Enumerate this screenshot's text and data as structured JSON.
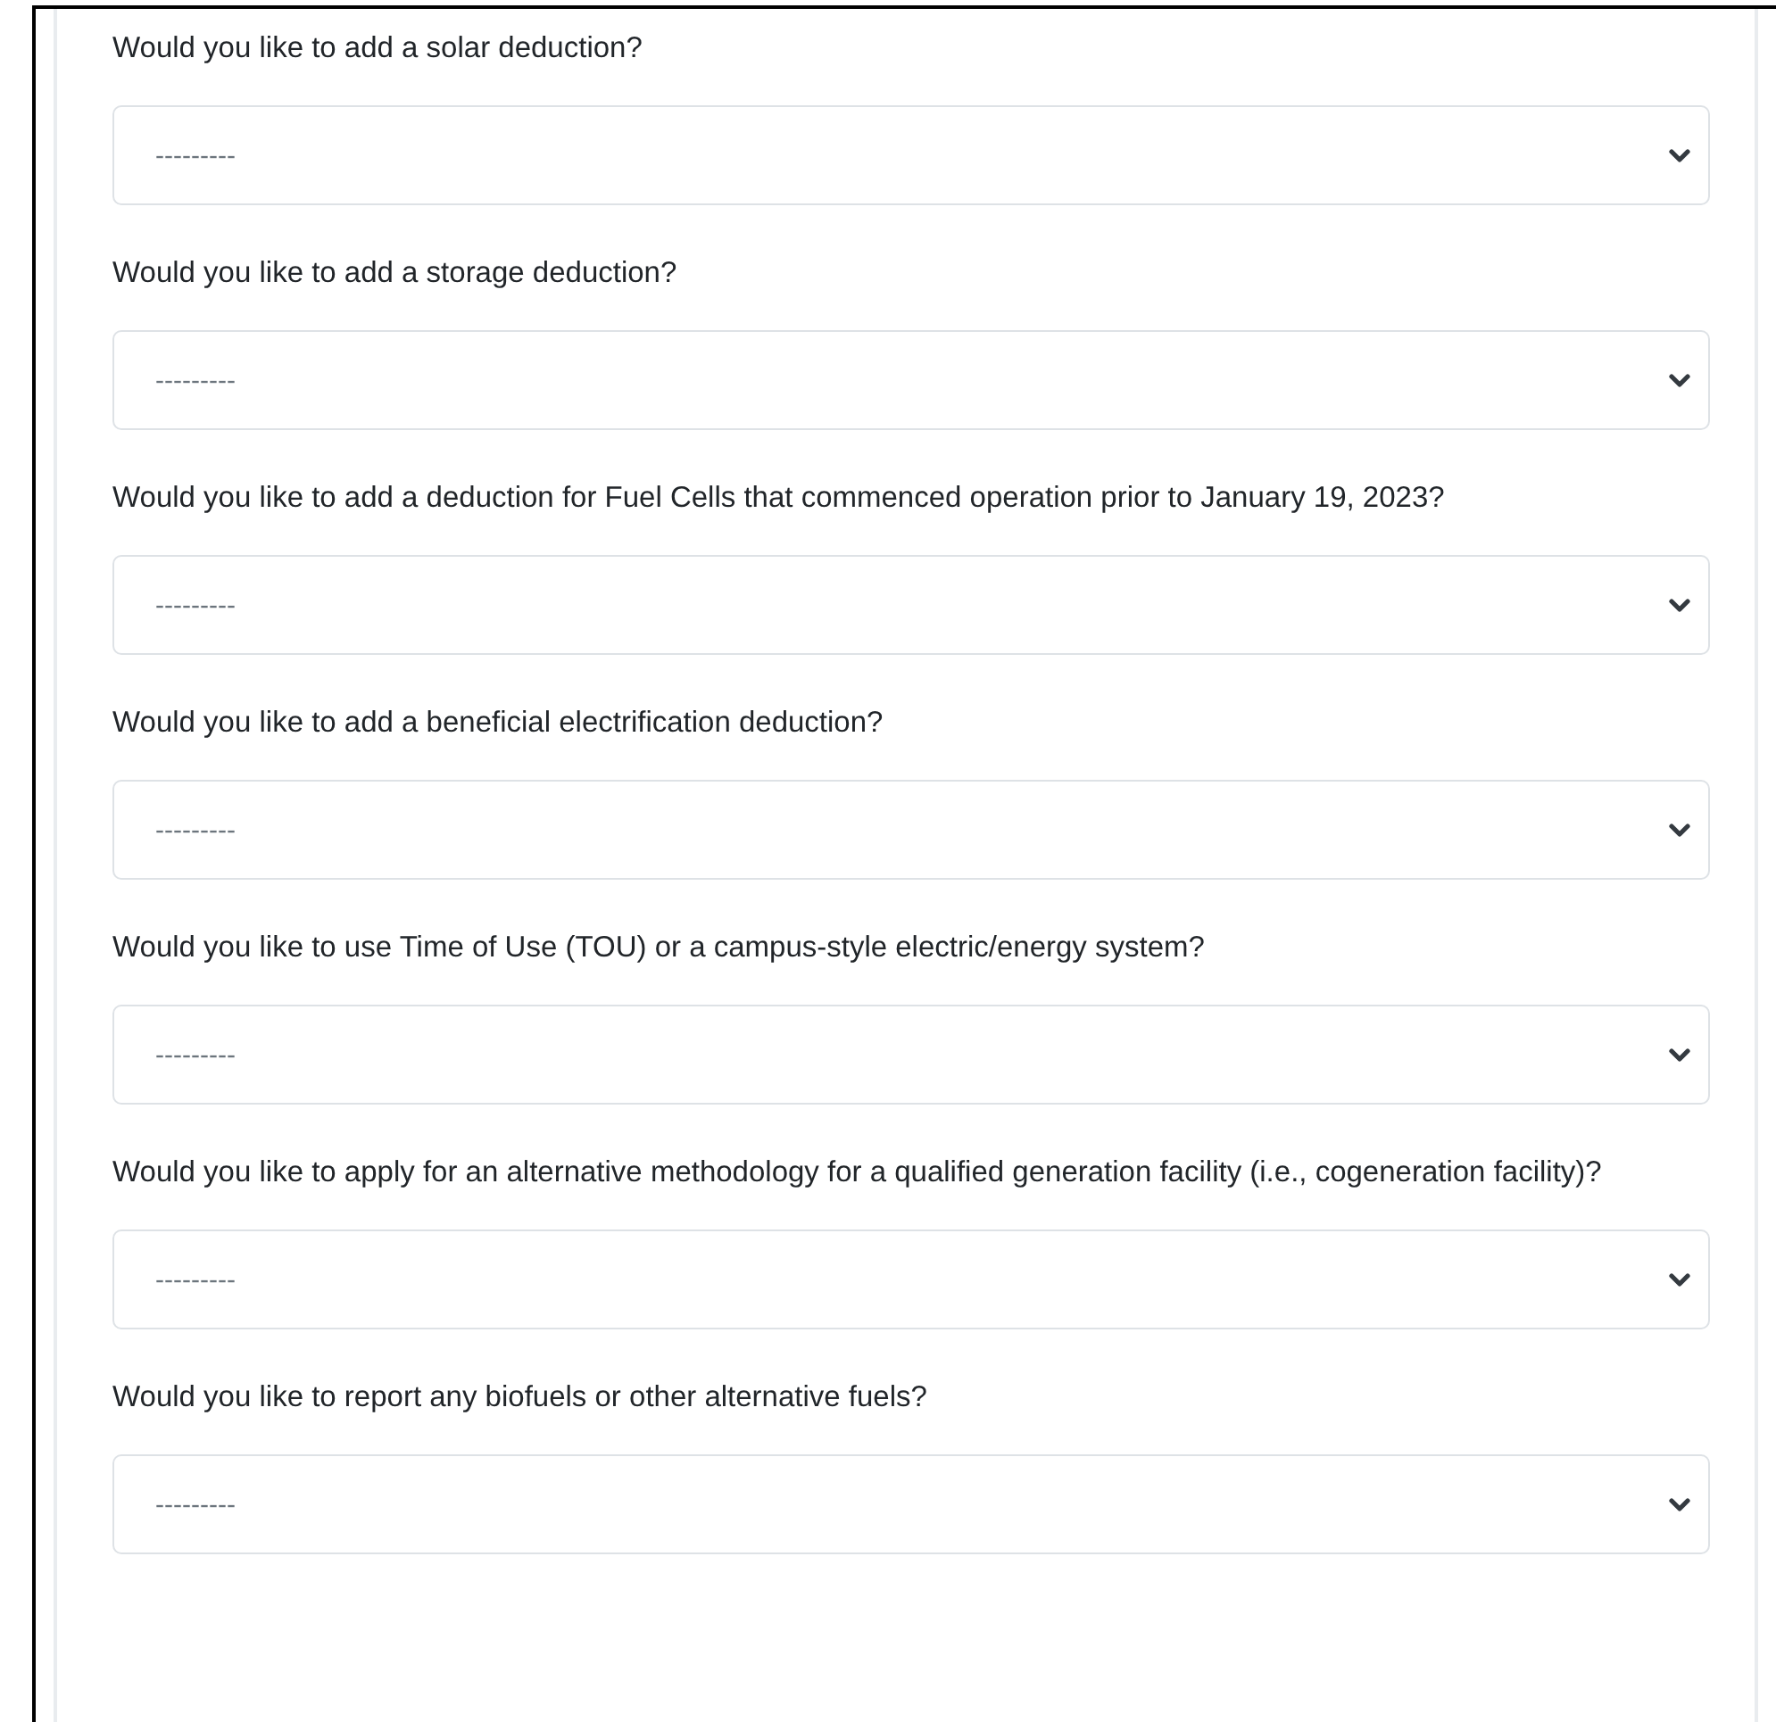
{
  "fields": [
    {
      "label": "Would you like to add a solar deduction?",
      "value": "---------"
    },
    {
      "label": "Would you like to add a storage deduction?",
      "value": "---------"
    },
    {
      "label": "Would you like to add a deduction for Fuel Cells that commenced operation prior to January 19, 2023?",
      "value": "---------"
    },
    {
      "label": "Would you like to add a beneficial electrification deduction?",
      "value": "---------"
    },
    {
      "label": "Would you like to use Time of Use (TOU) or a campus-style electric/energy system?",
      "value": "---------"
    },
    {
      "label": "Would you like to apply for an alternative methodology for a qualified generation facility (i.e., cogeneration facility)?",
      "value": "---------"
    },
    {
      "label": "Would you like to report any biofuels or other alternative fuels?",
      "value": "---------"
    }
  ]
}
